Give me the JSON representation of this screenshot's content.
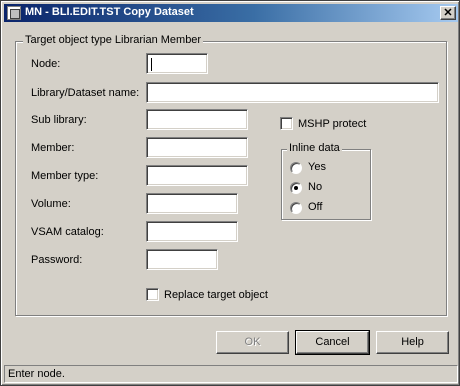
{
  "window": {
    "title": "MN - BLI.EDIT.TST Copy Dataset",
    "close_glyph": "✕"
  },
  "group": {
    "legend": "Target object type Librarian Member"
  },
  "fields": {
    "node_label": "Node:",
    "node_value": "",
    "library_label": "Library/Dataset name:",
    "library_value": "",
    "sublibrary_label": "Sub library:",
    "sublibrary_value": "",
    "member_label": "Member:",
    "member_value": "",
    "membertype_label": "Member type:",
    "membertype_value": "",
    "volume_label": "Volume:",
    "volume_value": "",
    "vsam_label": "VSAM catalog:",
    "vsam_value": "",
    "password_label": "Password:",
    "password_value": ""
  },
  "mshp": {
    "label": "MSHP protect",
    "checked": false
  },
  "inline": {
    "legend": "Inline data",
    "options": [
      {
        "label": "Yes",
        "checked": false
      },
      {
        "label": "No",
        "checked": true
      },
      {
        "label": "Off",
        "checked": false
      }
    ]
  },
  "replace": {
    "label": "Replace target object",
    "checked": false
  },
  "buttons": {
    "ok": "OK",
    "cancel": "Cancel",
    "help": "Help"
  },
  "status": {
    "text": "Enter node."
  }
}
